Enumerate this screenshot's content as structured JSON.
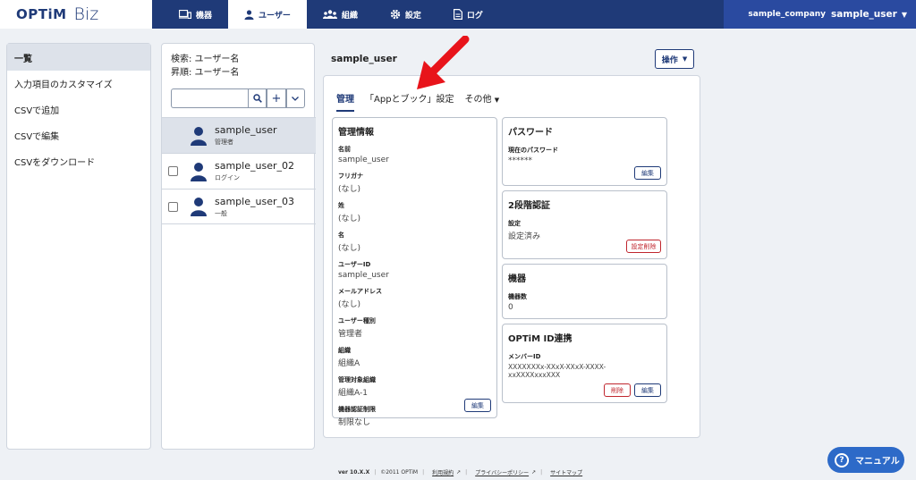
{
  "logo": {
    "brand": "OPTiM",
    "product": "Biz"
  },
  "nav": [
    {
      "label": "機器",
      "icon": "device-icon"
    },
    {
      "label": "ユーザー",
      "icon": "user-icon"
    },
    {
      "label": "組織",
      "icon": "organization-icon"
    },
    {
      "label": "設定",
      "icon": "gear-icon"
    },
    {
      "label": "ログ",
      "icon": "document-icon"
    }
  ],
  "account": {
    "company": "sample_company",
    "user": "sample_user"
  },
  "sidebar": {
    "items": [
      "一覧",
      "入力項目のカスタマイズ",
      "CSVで追加",
      "CSVで編集",
      "CSVをダウンロード"
    ]
  },
  "list": {
    "search_label": "検索: ユーザー名",
    "sort_label": "昇順: ユーザー名",
    "search_value": "",
    "users": [
      {
        "name": "sample_user",
        "role": "管理者"
      },
      {
        "name": "sample_user_02",
        "role": "ログイン"
      },
      {
        "name": "sample_user_03",
        "role": "一般"
      }
    ]
  },
  "detail": {
    "title": "sample_user",
    "operation_label": "操作",
    "tabs": [
      "管理",
      "「Appとブック」設定",
      "その他"
    ]
  },
  "management": {
    "title": "管理情報",
    "fields": [
      {
        "label": "名前",
        "value": "sample_user"
      },
      {
        "label": "フリガナ",
        "value": "(なし)"
      },
      {
        "label": "姓",
        "value": "(なし)"
      },
      {
        "label": "名",
        "value": "(なし)"
      },
      {
        "label": "ユーザーID",
        "value": "sample_user"
      },
      {
        "label": "メールアドレス",
        "value": "(なし)"
      },
      {
        "label": "ユーザー種別",
        "value": "管理者"
      },
      {
        "label": "組織",
        "value": "組織A"
      },
      {
        "label": "管理対象組織",
        "value": "組織A-1"
      },
      {
        "label": "機器認証制限",
        "value": "制限なし"
      }
    ],
    "edit_label": "編集"
  },
  "password": {
    "title": "パスワード",
    "label": "現在のパスワード",
    "value": "******",
    "edit_label": "編集"
  },
  "twofactor": {
    "title": "2段階認証",
    "label": "設定",
    "value": "設定済み",
    "delete_label": "設定削除"
  },
  "devices": {
    "title": "機器",
    "label": "機器数",
    "value": "0"
  },
  "optim_id": {
    "title": "OPTiM ID連携",
    "label": "メンバーID",
    "value_line1": "XXXXXXXx-XXxX-XXxX-XXXX-",
    "value_line2": "xxXXXXxxxXXX",
    "delete_label": "削除",
    "edit_label": "編集"
  },
  "footer": {
    "version": "ver 10.X.X",
    "copyright": "©2011 OPTiM",
    "terms": "利用規約",
    "privacy": "プライバシーポリシー",
    "sitemap": "サイトマップ"
  },
  "manual_label": "マニュアル",
  "colors": {
    "primary": "#1f3a78",
    "accent": "#2d6ac8",
    "danger": "#c0262e",
    "arrow": "#e8141b"
  }
}
